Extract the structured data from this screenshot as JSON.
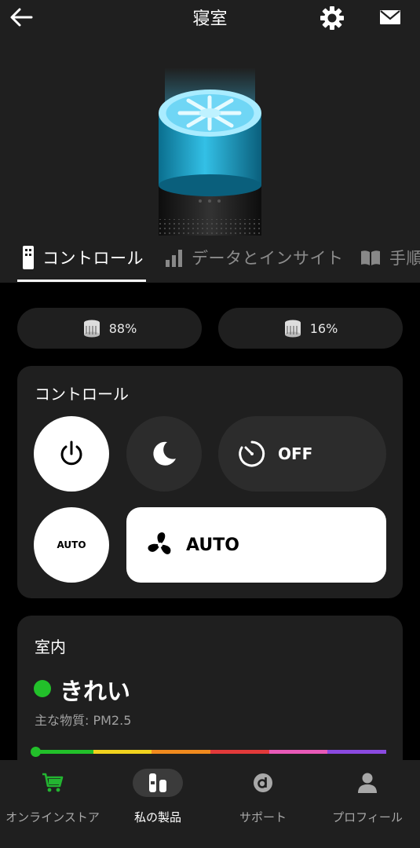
{
  "header": {
    "title": "寝室",
    "back_icon": "arrow-left-icon",
    "settings_icon": "gear-icon",
    "mail_icon": "envelope-icon"
  },
  "tabs": [
    {
      "label": "コントロール",
      "icon": "remote-icon",
      "active": true
    },
    {
      "label": "データとインサイト",
      "icon": "bar-chart-icon",
      "active": false
    },
    {
      "label": "手順",
      "icon": "book-icon",
      "active": false
    }
  ],
  "filters": [
    {
      "icon": "filter-icon",
      "value": "88%"
    },
    {
      "icon": "filter-icon",
      "value": "16%"
    }
  ],
  "control": {
    "title": "コントロール",
    "power_icon": "power-icon",
    "night_icon": "moon-icon",
    "timer_icon": "timer-icon",
    "timer_value": "OFF",
    "auto_mode_label": "AUTO",
    "fan_icon": "fan-icon",
    "fan_speed_label": "AUTO"
  },
  "indoor": {
    "title": "室内",
    "status": "きれい",
    "status_color": "#22c02a",
    "pollutant": "主な物質: PM2.5",
    "scale_colors": [
      "#22c02a",
      "#f0d21e",
      "#f08a1e",
      "#e23a3a",
      "#e85ab8",
      "#8a4ae0"
    ]
  },
  "bottom_nav": [
    {
      "label": "オンラインストア",
      "icon": "cart-icon",
      "active": false
    },
    {
      "label": "私の製品",
      "icon": "product-icon",
      "active": true
    },
    {
      "label": "サポート",
      "icon": "support-icon",
      "active": false
    },
    {
      "label": "プロフィール",
      "icon": "person-icon",
      "active": false
    }
  ]
}
